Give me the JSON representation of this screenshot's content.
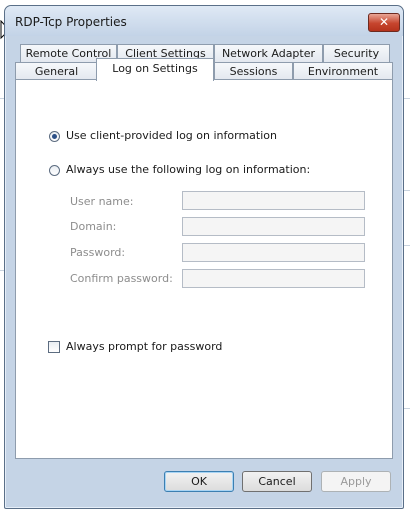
{
  "window": {
    "title": "RDP-Tcp Properties",
    "close_glyph": "✕"
  },
  "tabs": {
    "row_back": [
      "Remote Control",
      "Client Settings",
      "Network Adapter",
      "Security"
    ],
    "row_front": [
      "General",
      "Log on Settings",
      "Sessions",
      "Environment"
    ],
    "active": "Log on Settings"
  },
  "logon": {
    "option_client": "Use client-provided log on information",
    "option_always": "Always use the following log on information:",
    "selected_option": "client",
    "fields": {
      "user_name": {
        "label": "User name:",
        "value": ""
      },
      "domain": {
        "label": "Domain:",
        "value": ""
      },
      "password": {
        "label": "Password:",
        "value": ""
      },
      "confirm_password": {
        "label": "Confirm password:",
        "value": ""
      }
    },
    "prompt_password": {
      "label": "Always prompt for password",
      "checked": false
    }
  },
  "buttons": {
    "ok": "OK",
    "cancel": "Cancel",
    "apply": "Apply"
  },
  "colors": {
    "accent": "#2b4f87",
    "close": "#c6452e",
    "panel_bg": "#ffffff",
    "frame": "#c5d4e6"
  }
}
